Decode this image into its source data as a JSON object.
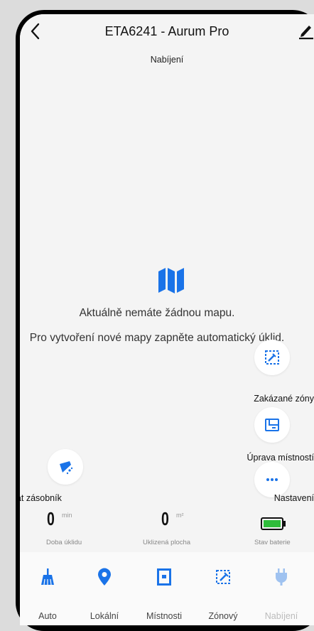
{
  "header": {
    "title": "ETA6241 - Aurum Pro",
    "subtitle": "Nabíjení"
  },
  "map": {
    "message_line1": "Aktuálně nemáte žádnou mapu.",
    "message_line2": "Pro vytvoření nové mapy zapněte automatický úklid."
  },
  "side_actions": {
    "forbidden_zones": "Zakázané zóny",
    "room_editing": "Úprava místností",
    "settings": "Nastavení",
    "empty_bin": "Odsát zásobník"
  },
  "stats": {
    "cleaning_time": {
      "value": "0",
      "unit": "min",
      "label": "Doba úklidu"
    },
    "cleaned_area": {
      "value": "0",
      "unit": "m²",
      "label": "Uklizená plocha"
    },
    "battery": {
      "label": "Stav baterie",
      "level": 1.0
    }
  },
  "tabs": [
    {
      "label": "Auto",
      "icon": "broom-icon"
    },
    {
      "label": "Lokální",
      "icon": "location-pin-icon"
    },
    {
      "label": "Místnosti",
      "icon": "room-icon"
    },
    {
      "label": "Zónový",
      "icon": "zone-icon"
    },
    {
      "label": "Nabíjení",
      "icon": "charging-plug-icon"
    }
  ],
  "colors": {
    "accent": "#1a73e8",
    "battery": "#2ebd3a",
    "disabled": "#bbbbbb"
  }
}
